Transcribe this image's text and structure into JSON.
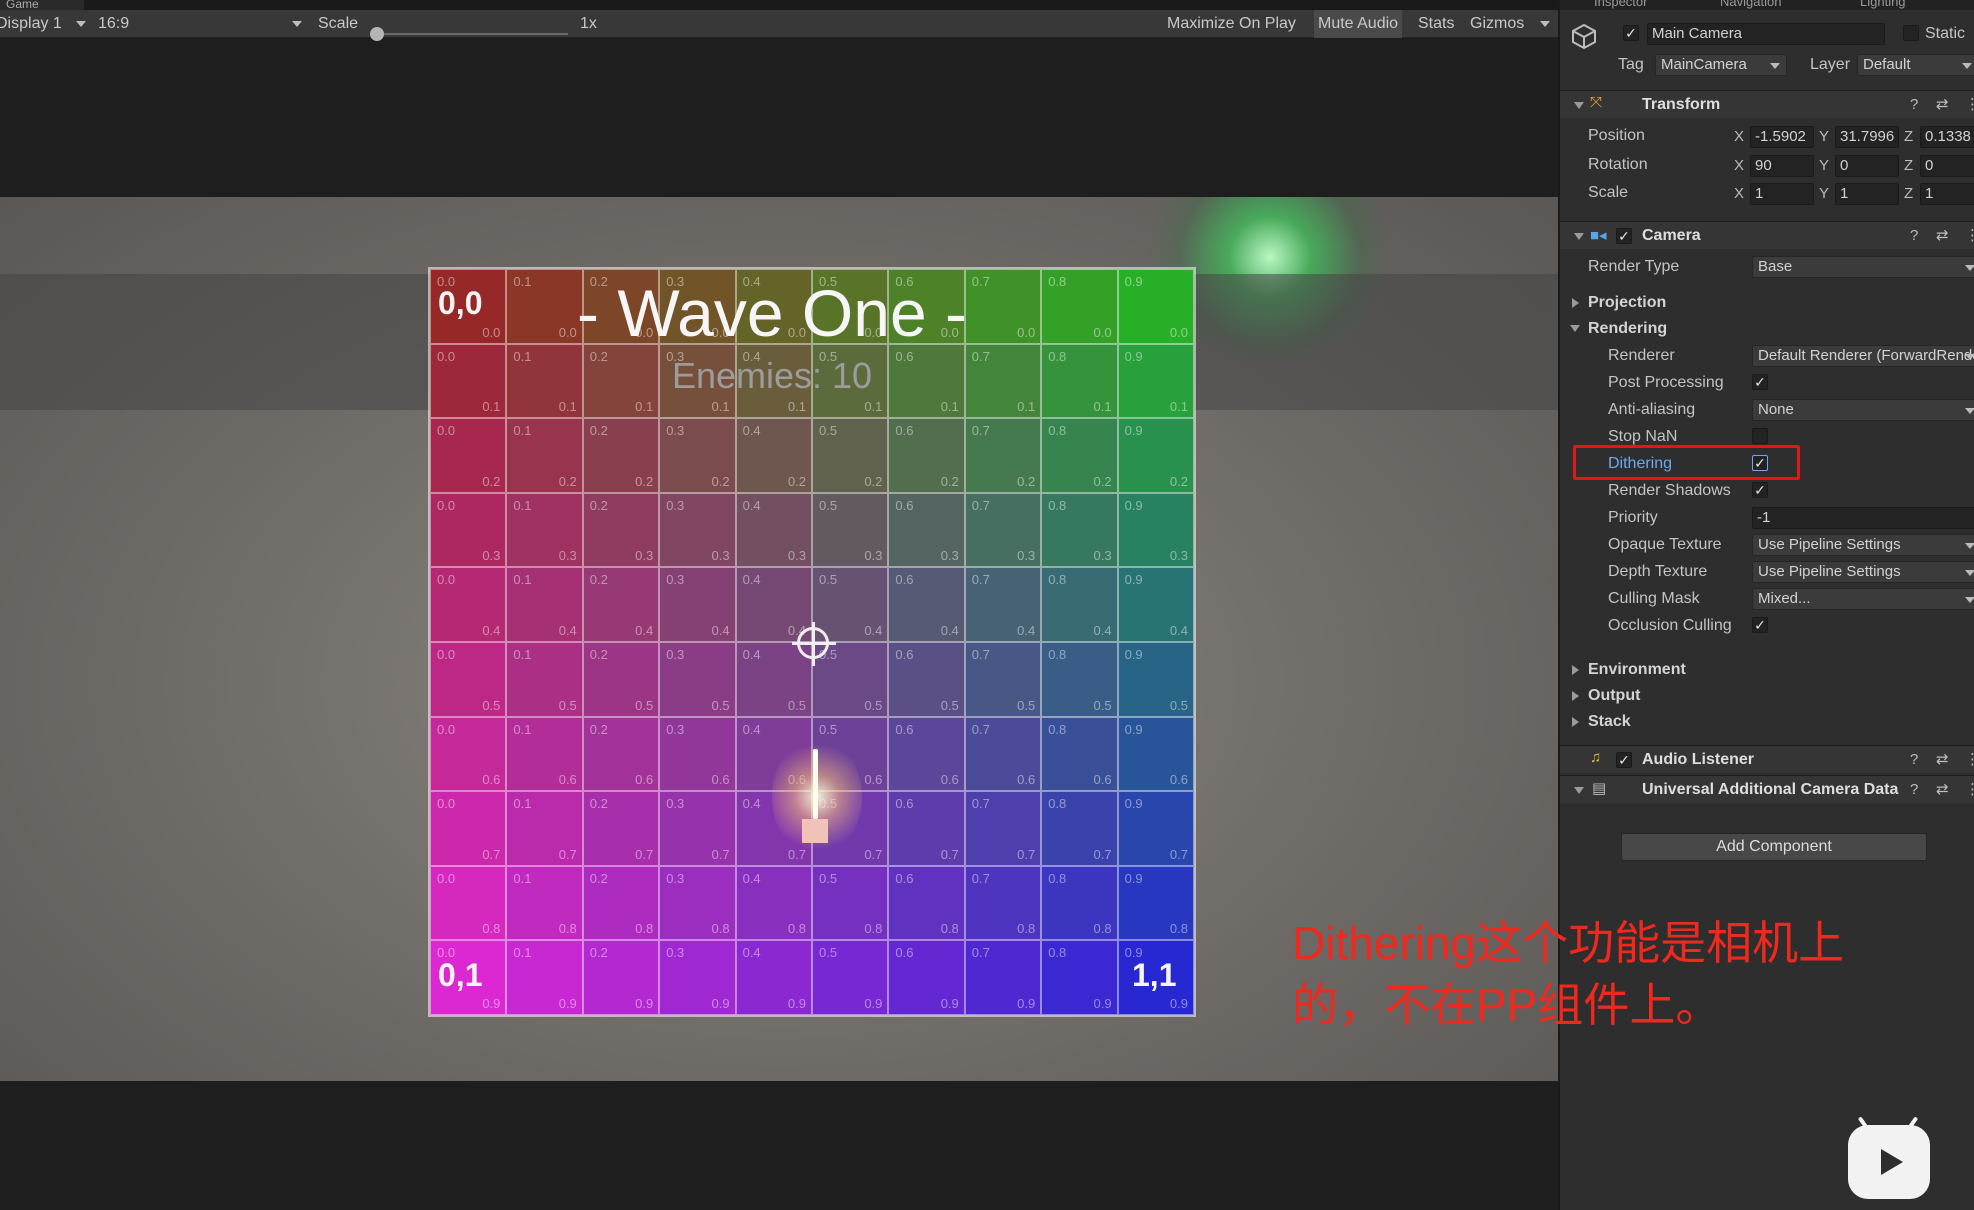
{
  "game_view": {
    "tab_label": "Game",
    "display": "Display 1",
    "aspect": "16:9",
    "scale_label": "Scale",
    "scale_value": "1x",
    "scale_level": 0.0,
    "maximize": "Maximize On Play",
    "mute": "Mute Audio",
    "stats": "Stats",
    "gizmos": "Gizmos"
  },
  "scene": {
    "wave_title": "- Wave One -",
    "enemies": "Enemies: 10",
    "corner_top_left": "0,0",
    "corner_bottom_left": "0,1",
    "corner_bottom_right": "1,1",
    "grid_x_labels": [
      "0.0",
      "0.1",
      "0.2",
      "0.3",
      "0.4",
      "0.5",
      "0.6",
      "0.7",
      "0.8",
      "0.9"
    ],
    "grid_y_labels": [
      "0.0",
      "0.1",
      "0.2",
      "0.3",
      "0.4",
      "0.5",
      "0.6",
      "0.7",
      "0.8",
      "0.9"
    ]
  },
  "inspector": {
    "tabs": [
      "Inspector",
      "Navigation",
      "Lighting"
    ],
    "object_name": "Main Camera",
    "static_label": "Static",
    "tag_label": "Tag",
    "tag_value": "MainCamera",
    "layer_label": "Layer",
    "layer_value": "Default",
    "transform": {
      "title": "Transform",
      "position_label": "Position",
      "rotation_label": "Rotation",
      "scale_label": "Scale",
      "position": {
        "x": "-1.5902",
        "y": "31.7996",
        "z": "0.1338"
      },
      "rotation": {
        "x": "90",
        "y": "0",
        "z": "0"
      },
      "scale": {
        "x": "1",
        "y": "1",
        "z": "1"
      }
    },
    "camera": {
      "title": "Camera",
      "render_type_label": "Render Type",
      "render_type": "Base",
      "projection": "Projection",
      "rendering": "Rendering",
      "renderer_label": "Renderer",
      "renderer_value": "Default Renderer (ForwardRenderer)",
      "post_processing": "Post Processing",
      "anti_aliasing_label": "Anti-aliasing",
      "anti_aliasing_value": "None",
      "stop_nan": "Stop NaN",
      "dithering": "Dithering",
      "render_shadows": "Render Shadows",
      "priority_label": "Priority",
      "priority_value": "-1",
      "opaque_texture_label": "Opaque Texture",
      "opaque_texture_value": "Use Pipeline Settings",
      "depth_texture_label": "Depth Texture",
      "depth_texture_value": "Use Pipeline Settings",
      "culling_mask_label": "Culling Mask",
      "culling_mask_value": "Mixed...",
      "occlusion_culling": "Occlusion Culling",
      "environment": "Environment",
      "output": "Output",
      "stack": "Stack"
    },
    "audio_listener": "Audio Listener",
    "additional_camera": "Universal Additional Camera Data",
    "add_component": "Add Component"
  },
  "annotation": {
    "line1": "Dithering这个功能是相机上",
    "line2": "的，不在PP组件上。"
  },
  "colors": {
    "highlight_red": "#e01818",
    "annotation_red": "#f0291e"
  },
  "icons": [
    "cube-icon",
    "transform-icon",
    "camera-icon",
    "headphones-icon",
    "script-icon",
    "help-icon",
    "preset-icon",
    "menu-icon",
    "bilibili-icon"
  ]
}
